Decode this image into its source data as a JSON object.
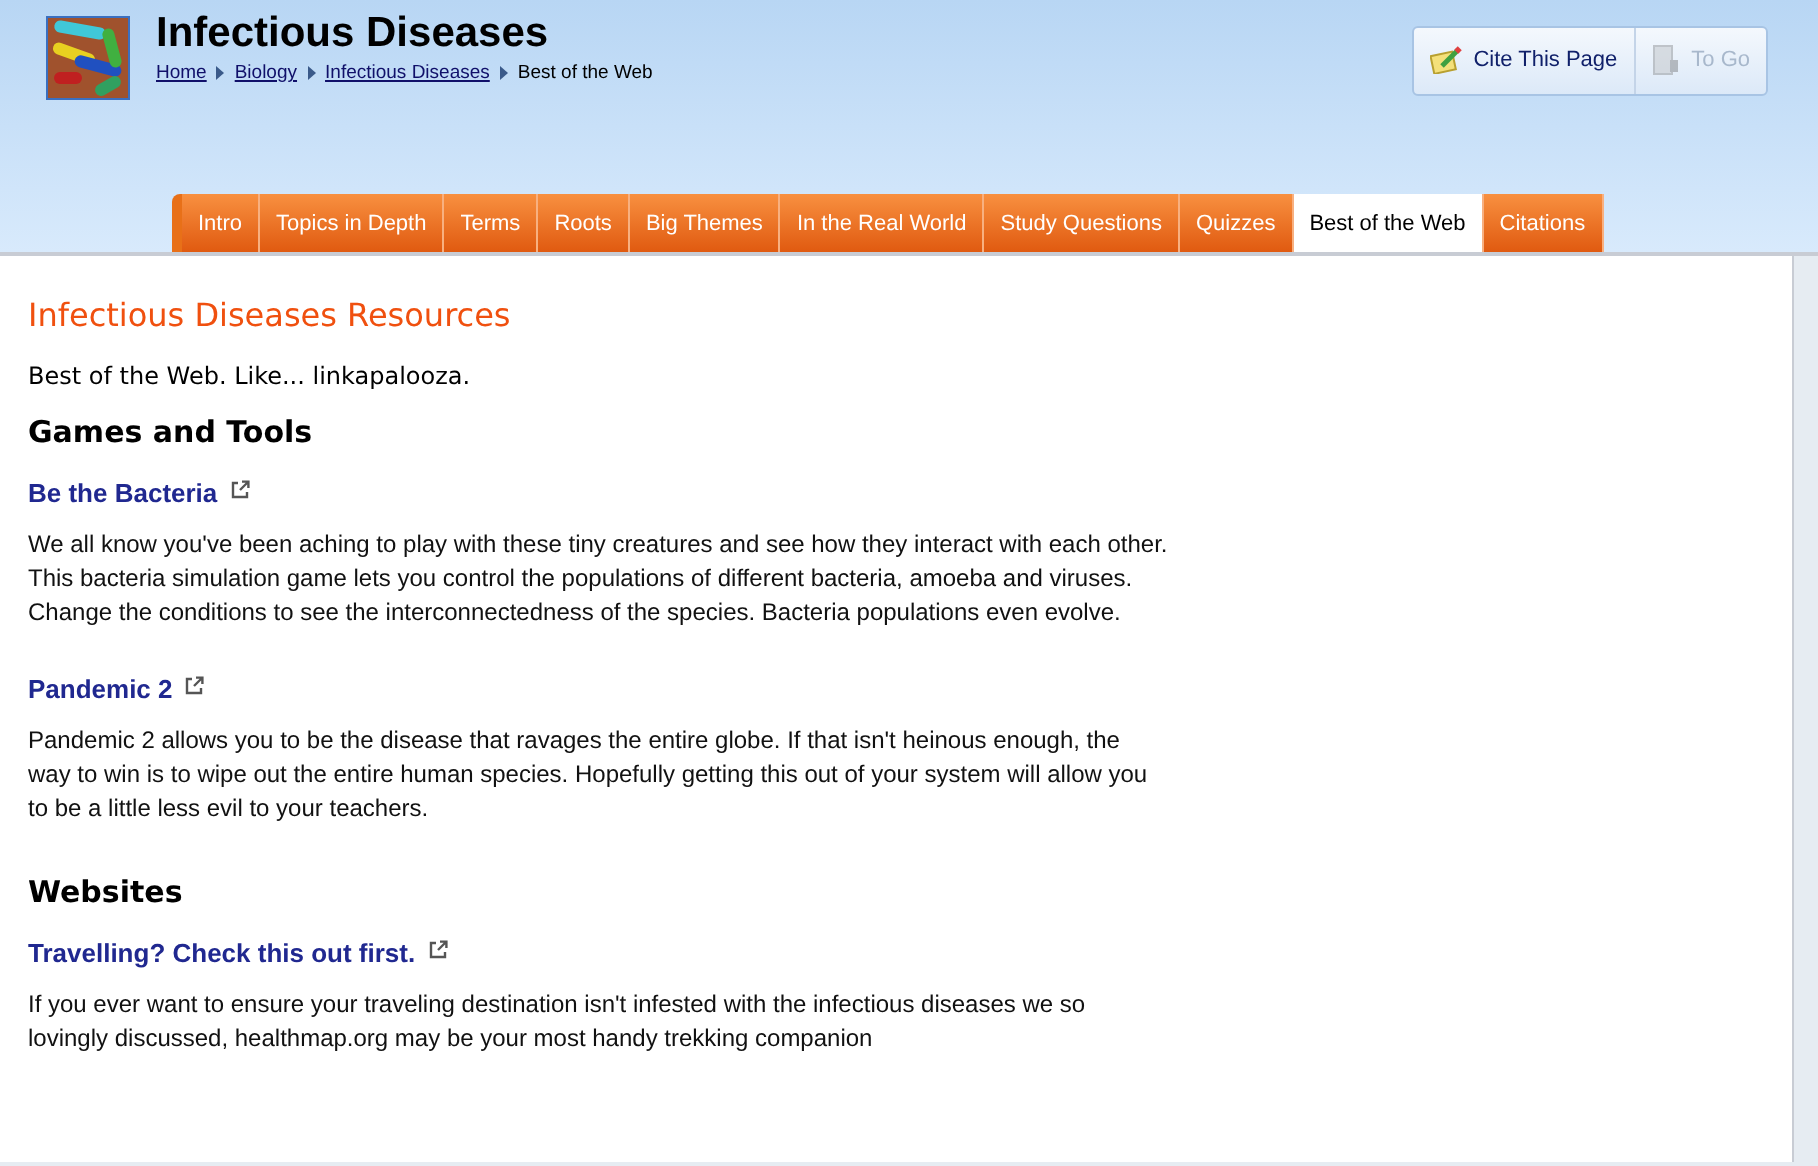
{
  "header": {
    "title": "Infectious Diseases",
    "breadcrumbs": [
      {
        "label": "Home",
        "kind": "link"
      },
      {
        "label": "Biology",
        "kind": "link"
      },
      {
        "label": "Infectious Diseases",
        "kind": "link"
      },
      {
        "label": "Best of the Web",
        "kind": "current"
      }
    ]
  },
  "actions": [
    {
      "label": "Cite This Page",
      "disabled": false,
      "kind": "cite"
    },
    {
      "label": "To Go",
      "disabled": true,
      "kind": "togo"
    }
  ],
  "tabs": [
    {
      "label": "Intro",
      "selected": false
    },
    {
      "label": "Topics in Depth",
      "selected": false
    },
    {
      "label": "Terms",
      "selected": false
    },
    {
      "label": "Roots",
      "selected": false
    },
    {
      "label": "Big Themes",
      "selected": false
    },
    {
      "label": "In the Real World",
      "selected": false
    },
    {
      "label": "Study Questions",
      "selected": false
    },
    {
      "label": "Quizzes",
      "selected": false
    },
    {
      "label": "Best of the Web",
      "selected": true
    },
    {
      "label": "Citations",
      "selected": false
    }
  ],
  "content": {
    "heading": "Infectious Diseases Resources",
    "intro": "Best of the Web. Like... linkapalooza.",
    "sections": [
      {
        "title": "Games and Tools",
        "items": [
          {
            "link": "Be the Bacteria",
            "text": "We all know you've been aching to play with these tiny creatures and see how they interact with each other. This bacteria simulation game lets you control the populations of different bacteria, amoeba and viruses. Change the conditions to see the interconnectedness of the species. Bacteria populations even evolve."
          },
          {
            "link": "Pandemic 2",
            "text": "Pandemic 2 allows you to be the disease that ravages the entire globe. If that isn't heinous enough, the way to win is to wipe out the entire human species. Hopefully getting this out of your system will allow you to be a little less evil to your teachers."
          }
        ]
      },
      {
        "title": "Websites",
        "items": [
          {
            "link": "Travelling? Check this out first.",
            "text": "If you ever want to ensure your traveling destination isn't infested with the infectious diseases we so lovingly discussed, healthmap.org may be your most handy trekking companion"
          }
        ]
      }
    ]
  }
}
